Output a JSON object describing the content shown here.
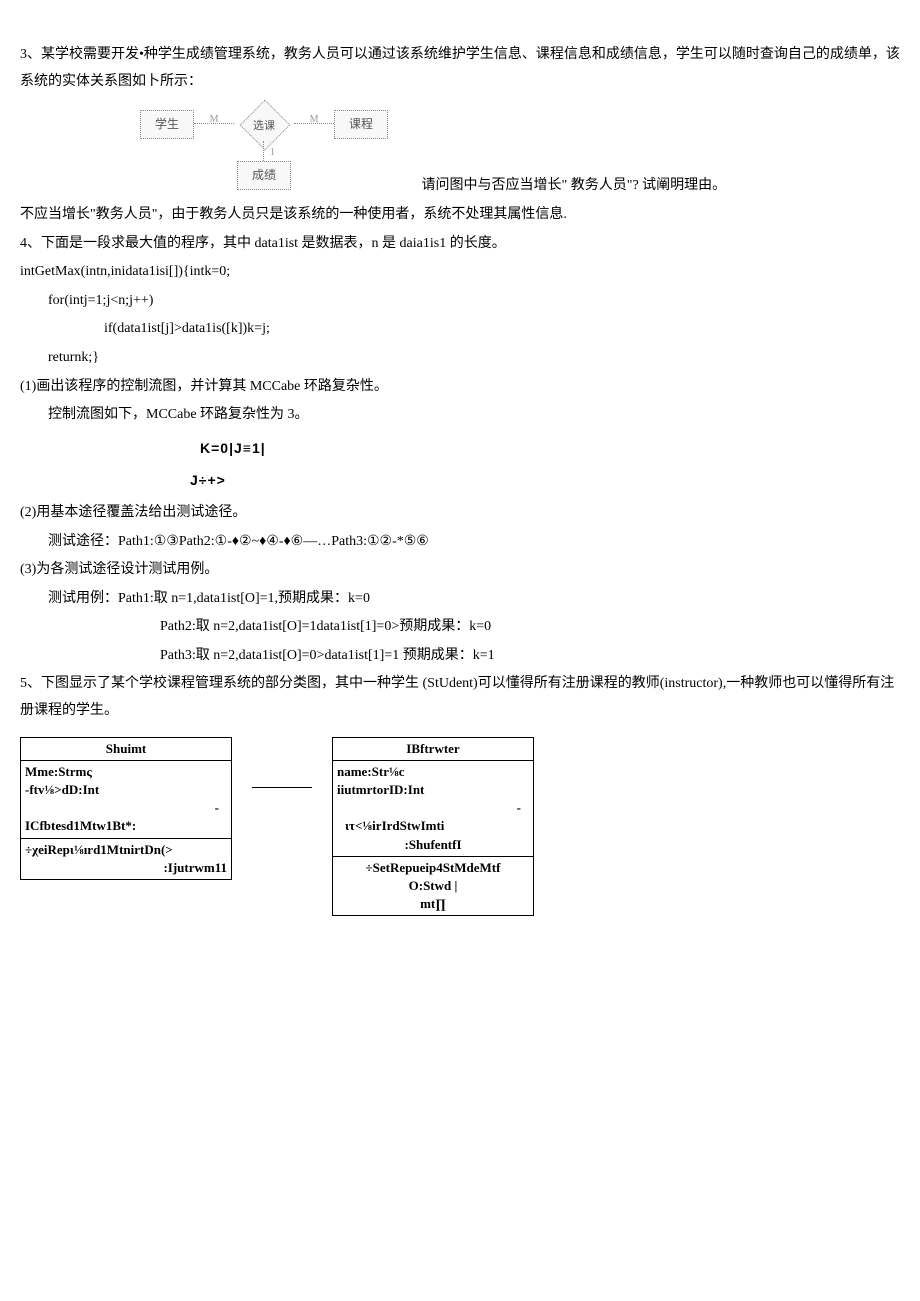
{
  "q3": {
    "prompt": "3、某学校需要开发•种学生成绩管理系统，教务人员可以通过该系统维护学生信息、课程信息和成绩信息，学生可以随时查询自己的成绩单，该系统的实体关系图如卜所示：",
    "er": {
      "left": "学生",
      "center": "选课",
      "right": "课程",
      "bottom": "成绩",
      "m1": "M",
      "m2": "M",
      "one": "1"
    },
    "q": "请问图中与否应当增长\" 教务人员\"? 试阐明理由。",
    "ans": "不应当增长\"教务人员\"，由于教务人员只是该系统的一种使用者，系统不处理其属性信息."
  },
  "q4": {
    "prompt": "4、下面是一段求最大值的程序，其中 data1ist 是数据表，n 是 daia1is1 的长度。",
    "code1": "intGetMax(intn,inidata1isi[]){intk=0;",
    "code2": "for(intj=1;j<n;j++)",
    "code3": "if(data1ist[j]>data1is([k])k=j;",
    "code4": "returnk;}",
    "sub1": "(1)画出该程序的控制流图，并计算其 MCCabe 环路复杂性。",
    "ans1": "控制流图如下，MCCabe 环路复杂性为 3。",
    "flow1": "K=0|J≡1|",
    "flow2": "J÷+>",
    "sub2": "(2)用基本途径覆盖法给出测试途径。",
    "ans2": "测试途径：Path1:①③Path2:①-♦②~♦④-♦⑥—…Path3:①②-*⑤⑥",
    "sub3": "(3)为各测试途径设计测试用例。",
    "ans3a": "测试用例：Path1:取 n=1,data1ist[O]=1,预期成果：k=0",
    "ans3b": "Path2:取 n=2,data1ist[O]=1data1ist[1]=0>预期成果：k=0",
    "ans3c": "Path3:取 n=2,data1ist[O]=0>data1ist[1]=1 预期成果：k=1"
  },
  "q5": {
    "prompt": "5、下图显示了某个学校课程管理系统的部分类图，其中一种学生 (StUdent)可以懂得所有注册课程的教师(instructor),一种教师也可以懂得所有注册课程的学生。",
    "uml_left": {
      "title": "Shuimt",
      "attr1": "Mme:Strmς",
      "attr2": "-ftv⅛>dD:Int",
      "dash": "-",
      "attr3": "ICfbtesd1Mtw1Bt*:",
      "op1": "÷χeiRepι⅛ırd1MtnirtDn(>",
      "op2": ":Ijutrwm11"
    },
    "uml_right": {
      "title": "IBftrwter",
      "attr1": "name:Str⅛c",
      "attr2": "iiutmrtorID:Int",
      "dash": "-",
      "attr3": "ιτ<⅛irIrdStwImti",
      "attr4": ":ShufentfI",
      "op1": "÷SetRepueip4StMdeMtf",
      "op2": "O:Stwd |",
      "op3": "mt∏"
    }
  }
}
